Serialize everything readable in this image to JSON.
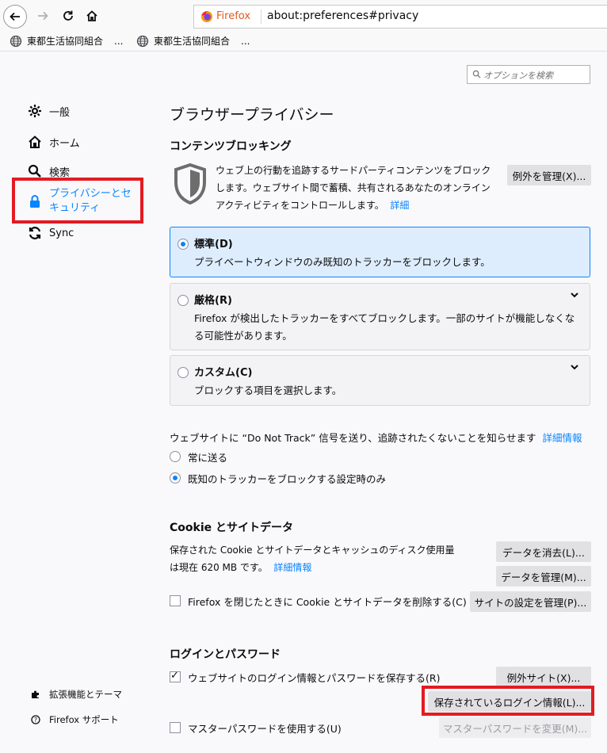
{
  "browser": {
    "firefox_label": "Firefox",
    "url": "about:preferences#privacy",
    "bookmarks": [
      {
        "label": "東都生活協同組合",
        "more": "..."
      },
      {
        "label": "東都生活協同組合",
        "more": "..."
      }
    ]
  },
  "search": {
    "placeholder": "オプションを検索"
  },
  "sidebar": {
    "items": [
      {
        "label": "一般"
      },
      {
        "label": "ホーム"
      },
      {
        "label": "検索"
      },
      {
        "label_line1": "プライバシーとセ",
        "label_line2": "キュリティ"
      },
      {
        "label": "Sync"
      }
    ],
    "footer": [
      {
        "label": "拡張機能とテーマ"
      },
      {
        "label": "Firefox サポート"
      }
    ],
    "active_color": "#0a84ff",
    "highlight_color": "#e31b23"
  },
  "main": {
    "title": "ブラウザープライバシー",
    "content_blocking": {
      "heading": "コンテンツブロッキング",
      "desc_line1": "ウェブ上の行動を追跡するサードパーティコンテンツをブロック",
      "desc_line2": "します。ウェブサイト間で蓄積、共有されるあなたのオンライン",
      "desc_line3": "アクティビティをコントロールします。",
      "desc_link": "詳細",
      "exceptions_button": "例外を管理(X)...",
      "options": [
        {
          "title": "標準(D)",
          "desc": "プライベートウィンドウのみ既知のトラッカーをブロックします。",
          "selected": true
        },
        {
          "title": "厳格(R)",
          "desc_line1": "Firefox が検出したトラッカーをすべてブロックします。一部のサイトが機能しなくな",
          "desc_line2": "る可能性があります。",
          "selected": false
        },
        {
          "title": "カスタム(C)",
          "desc": "ブロックする項目を選択します。",
          "selected": false
        }
      ]
    },
    "dnt": {
      "text": "ウェブサイトに “Do Not Track” 信号を送り、追跡されたくないことを知らせます",
      "link": "詳細情報",
      "options": [
        {
          "label": "常に送る",
          "selected": false
        },
        {
          "label": "既知のトラッカーをブロックする設定時のみ",
          "selected": true
        }
      ]
    },
    "cookies": {
      "heading": "Cookie とサイトデータ",
      "desc_line1": "保存された Cookie とサイトデータとキャッシュのディスク使用量",
      "desc_line2": "は現在 620 MB です。",
      "link": "詳細情報",
      "clear_button": "データを消去(L)...",
      "manage_button": "データを管理(M)...",
      "delete_on_close": "Firefox を閉じたときに Cookie とサイトデータを削除する(C)",
      "site_settings_button": "サイトの設定を管理(P)..."
    },
    "logins": {
      "heading": "ログインとパスワード",
      "save_logins": "ウェブサイトのログイン情報とパスワードを保存する(R)",
      "exceptions_button": "例外サイト(X)...",
      "saved_logins_button": "保存されているログイン情報(L)...",
      "master_password": "マスターパスワードを使用する(U)",
      "change_master_button": "マスターパスワードを変更(M)..."
    }
  }
}
